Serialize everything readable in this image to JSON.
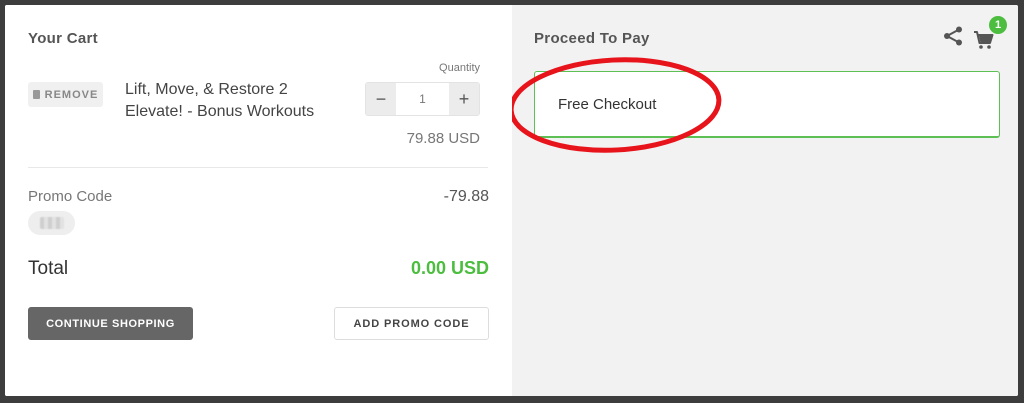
{
  "cart": {
    "title": "Your Cart",
    "item": {
      "remove_label": "REMOVE",
      "name_line1": "Lift, Move, & Restore 2",
      "name_line2": "Elevate! - Bonus Workouts",
      "quantity_label": "Quantity",
      "quantity_value": "1",
      "decrement_symbol": "−",
      "increment_symbol": "+",
      "price": "79.88 USD"
    },
    "promo": {
      "label": "Promo Code",
      "amount": "-79.88"
    },
    "total": {
      "label": "Total",
      "amount": "0.00 USD"
    },
    "buttons": {
      "continue_shopping": "CONTINUE SHOPPING",
      "add_promo_code": "ADD PROMO CODE"
    }
  },
  "payment": {
    "title": "Proceed To Pay",
    "free_checkout_label": "Free Checkout",
    "cart_count": "1"
  },
  "icons": [
    "trash-icon",
    "share-icon",
    "cart-icon"
  ],
  "colors": {
    "accent_green": "#4cbd3f",
    "highlight_red": "#e8141b",
    "dark_button": "#666666",
    "right_panel_bg": "#f2f2f2"
  }
}
